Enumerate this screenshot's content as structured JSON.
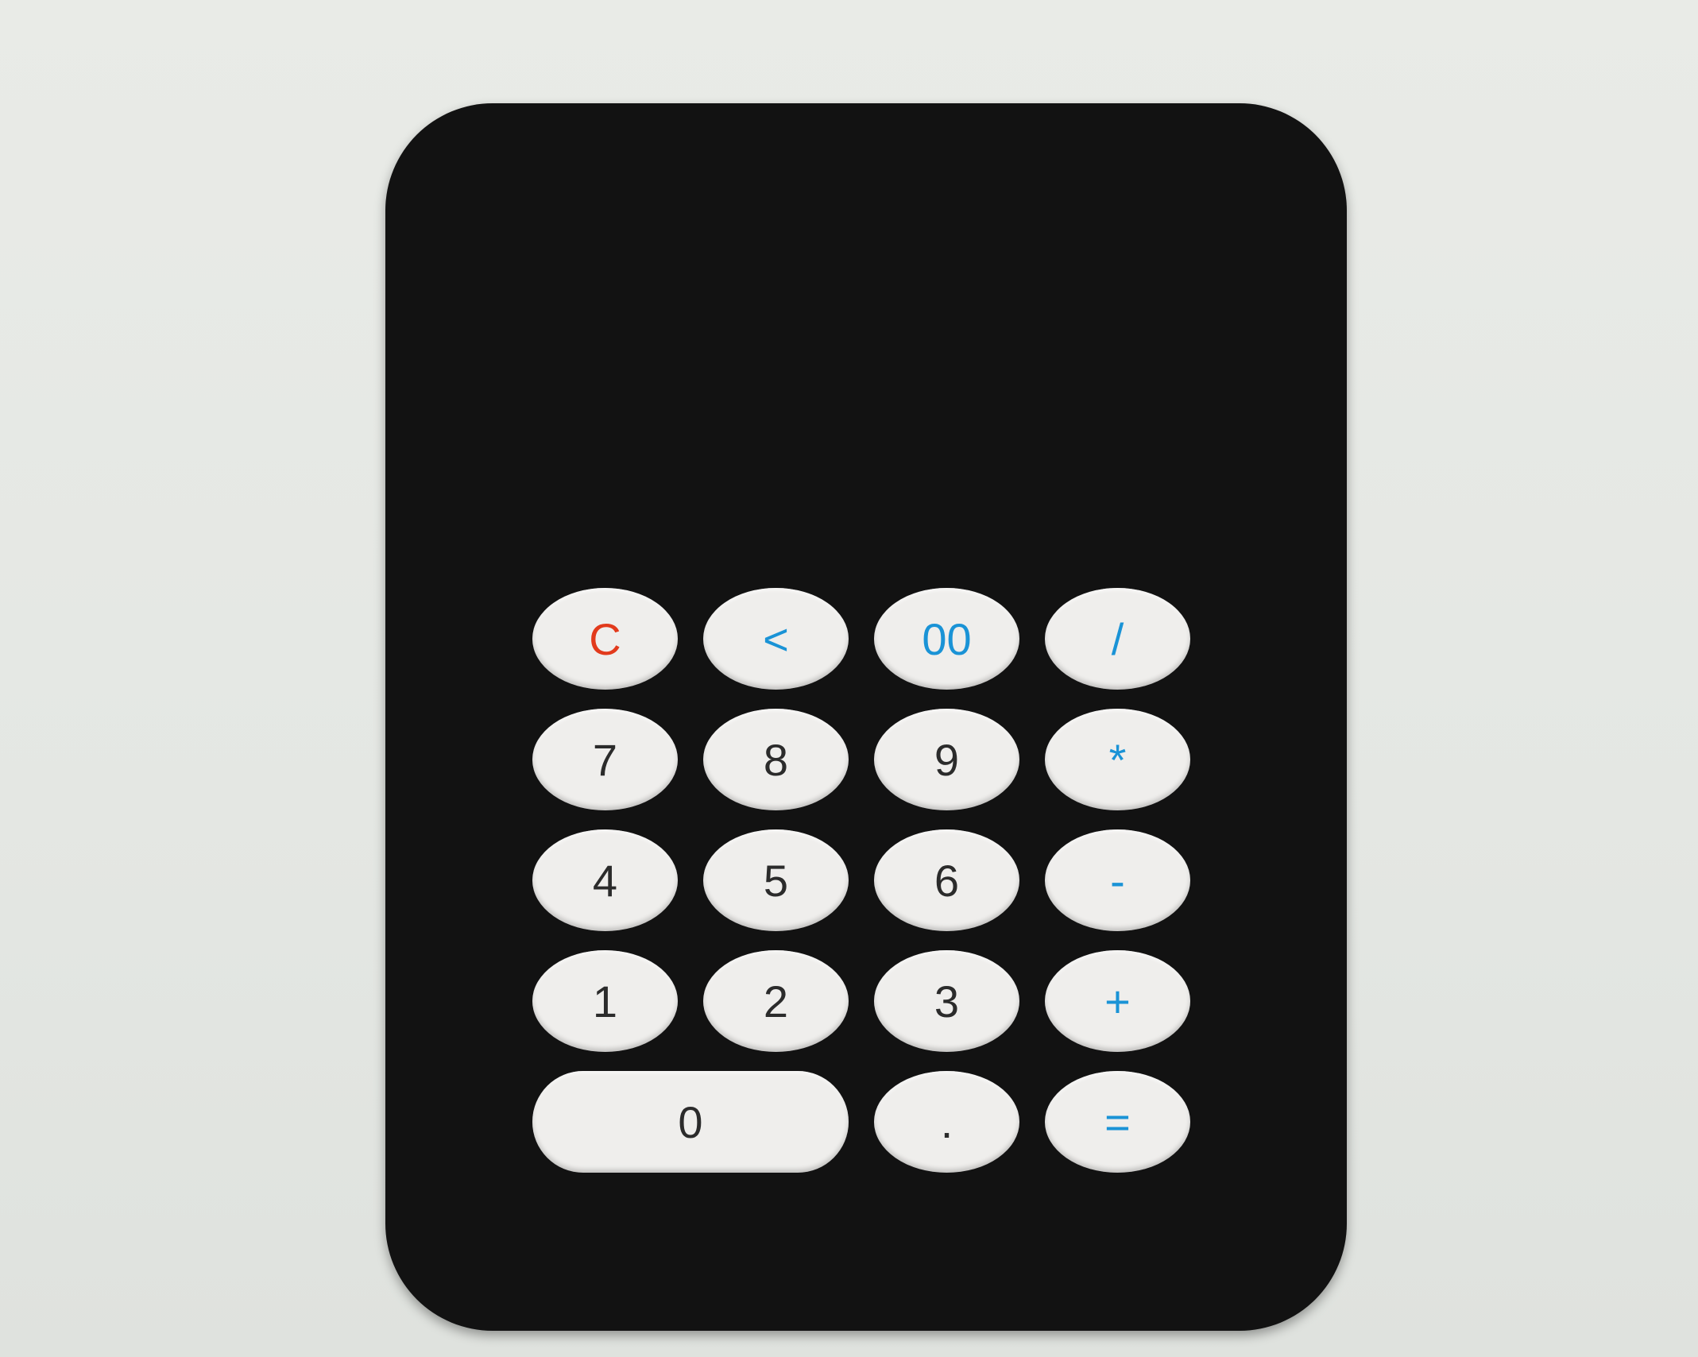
{
  "display": {
    "value": ""
  },
  "keys": {
    "clear": "C",
    "backspace": "<",
    "double_zero": "00",
    "divide": "/",
    "seven": "7",
    "eight": "8",
    "nine": "9",
    "multiply": "*",
    "four": "4",
    "five": "5",
    "six": "6",
    "subtract": "-",
    "one": "1",
    "two": "2",
    "three": "3",
    "add": "+",
    "zero": "0",
    "decimal": ".",
    "equals": "="
  },
  "colors": {
    "body": "#121212",
    "key_face": "#efeeec",
    "digit_text": "#2b2b2b",
    "clear_text": "#e23a1c",
    "operator_text": "#1a93d6"
  }
}
